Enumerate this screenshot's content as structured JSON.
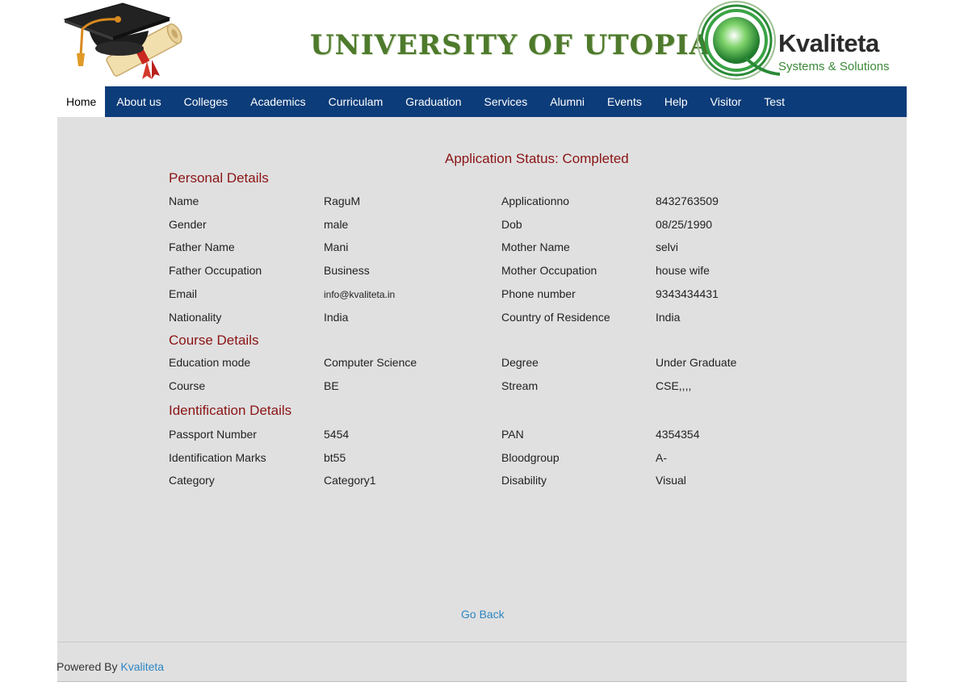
{
  "header": {
    "title": "UNIVERSITY OF UTOPIA",
    "brand_name": "Kvaliteta",
    "brand_tagline": "Systems & Solutions",
    "brand_letter": "Q"
  },
  "nav": {
    "items": [
      "Home",
      "About us",
      "Colleges",
      "Academics",
      "Curriculam",
      "Graduation",
      "Services",
      "Alumni",
      "Events",
      "Help",
      "Visitor",
      "Test"
    ],
    "active": "Home"
  },
  "status": "Application Status: Completed",
  "personal": {
    "title": "Personal Details",
    "rows": [
      [
        "Name",
        "RaguM",
        "Applicationno",
        "8432763509"
      ],
      [
        "Gender",
        "male",
        "Dob",
        "08/25/1990"
      ],
      [
        "Father Name",
        "Mani",
        "Mother Name",
        "selvi"
      ],
      [
        "Father Occupation",
        "Business",
        "Mother Occupation",
        "house wife"
      ],
      [
        "Email",
        "info@kvaliteta.in",
        "Phone number",
        "9343434431"
      ],
      [
        "Nationality",
        "India",
        "Country of Residence",
        "India"
      ]
    ]
  },
  "course": {
    "title": "Course Details",
    "rows": [
      [
        "Education mode",
        "Computer Science",
        "Degree",
        "Under Graduate"
      ],
      [
        "Course",
        "BE",
        "Stream",
        "CSE,,,,"
      ]
    ]
  },
  "identification": {
    "title": "Identification Details",
    "rows": [
      [
        "Passport Number",
        "5454",
        "PAN",
        "4354354"
      ],
      [
        "Identification Marks",
        "bt55",
        "Bloodgroup",
        "A-"
      ],
      [
        "Category",
        "Category1",
        "Disability",
        "Visual"
      ]
    ]
  },
  "go_back": "Go Back",
  "footer": {
    "powered_by": "Powered By",
    "link": "Kvaliteta"
  },
  "colors": {
    "nav_bg": "#0c3c79",
    "section_title": "#8b1414",
    "title_green": "#4e7a2c",
    "link": "#2d86c1",
    "content_bg": "#e0e0e1"
  }
}
